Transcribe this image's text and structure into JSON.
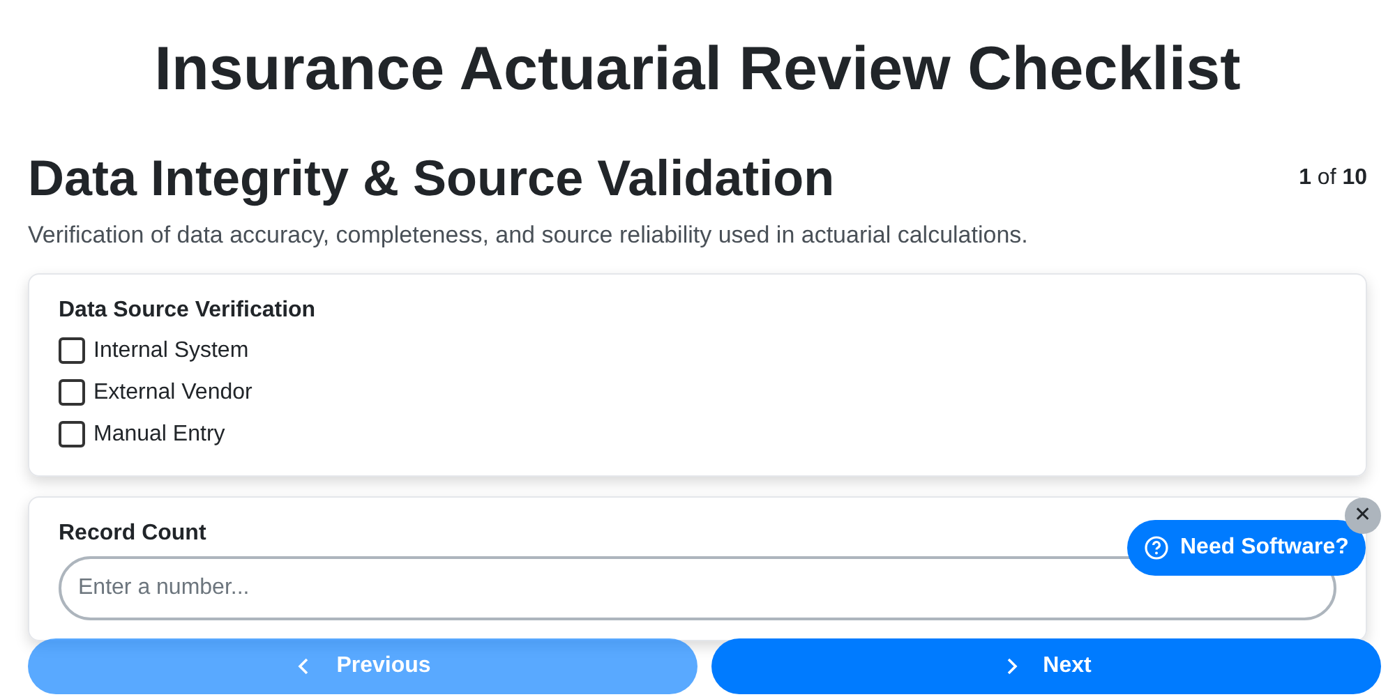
{
  "title": "Insurance Actuarial Review Checklist",
  "section": {
    "heading": "Data Integrity & Source Validation",
    "progress": "**1** of **10**",
    "description": "Verification of data accuracy, completeness, and source reliability used in actuarial calculations."
  },
  "questions": [
    {
      "kind": "checkboxes",
      "label": "Data Source Verification",
      "options": [
        {
          "label": "Internal System",
          "checked": false
        },
        {
          "label": "External Vendor",
          "checked": false
        },
        {
          "label": "Manual Entry",
          "checked": false
        }
      ]
    },
    {
      "kind": "number",
      "label": "Record Count",
      "placeholder": "Enter a number..."
    }
  ],
  "nav": [
    {
      "kind": "previous",
      "label": "Previous",
      "disabled": true
    },
    {
      "kind": "next",
      "label": "Next",
      "disabled": false
    }
  ],
  "help": {
    "label": "Need Software?",
    "close": "✕"
  }
}
